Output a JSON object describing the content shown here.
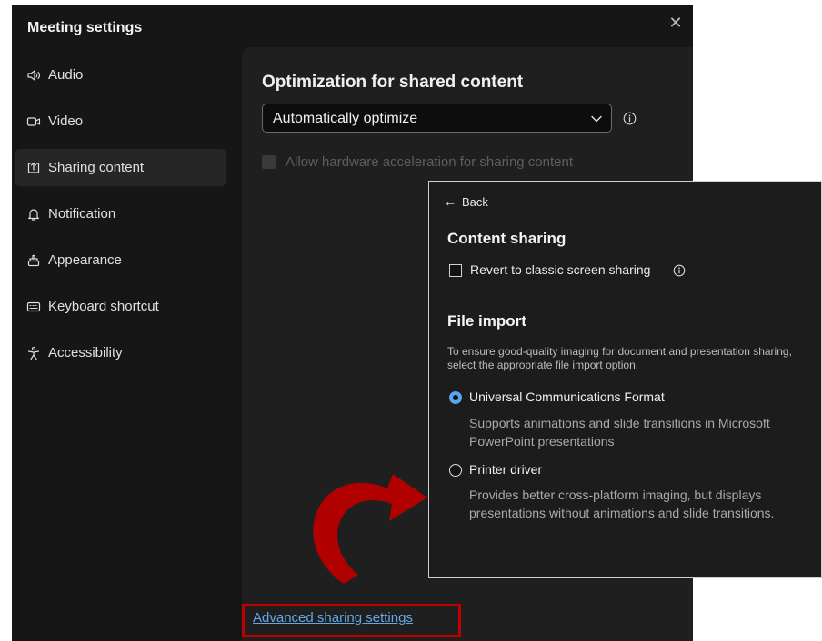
{
  "window": {
    "title": "Meeting settings",
    "close_icon": "close-icon"
  },
  "sidebar": {
    "items": [
      {
        "label": "Audio",
        "icon": "speaker-icon"
      },
      {
        "label": "Video",
        "icon": "camera-icon"
      },
      {
        "label": "Sharing content",
        "icon": "share-icon",
        "active": true
      },
      {
        "label": "Notification",
        "icon": "bell-icon"
      },
      {
        "label": "Appearance",
        "icon": "paint-icon"
      },
      {
        "label": "Keyboard shortcut",
        "icon": "keyboard-icon"
      },
      {
        "label": "Accessibility",
        "icon": "accessibility-icon"
      }
    ]
  },
  "content": {
    "section_title": "Optimization for shared content",
    "dropdown_value": "Automatically optimize",
    "hardware_accel_label": "Allow hardware acceleration for sharing content",
    "advanced_link": "Advanced sharing settings"
  },
  "popup": {
    "back_label": "Back",
    "content_sharing_title": "Content sharing",
    "revert_label": "Revert to classic screen sharing",
    "file_import_title": "File import",
    "file_import_desc": "To ensure good-quality imaging for document and presentation sharing, select the appropriate file import option.",
    "options": [
      {
        "label": "Universal Communications Format",
        "desc": "Supports animations and slide transitions in Microsoft PowerPoint presentations",
        "selected": true
      },
      {
        "label": "Printer driver",
        "desc": "Provides better cross-platform imaging, but displays presentations without animations and slide transitions.",
        "selected": false
      }
    ]
  },
  "colors": {
    "highlight": "#c00000",
    "link": "#62a8e8",
    "radio_accent": "#5aa4ee",
    "arrow": "#b00000"
  }
}
